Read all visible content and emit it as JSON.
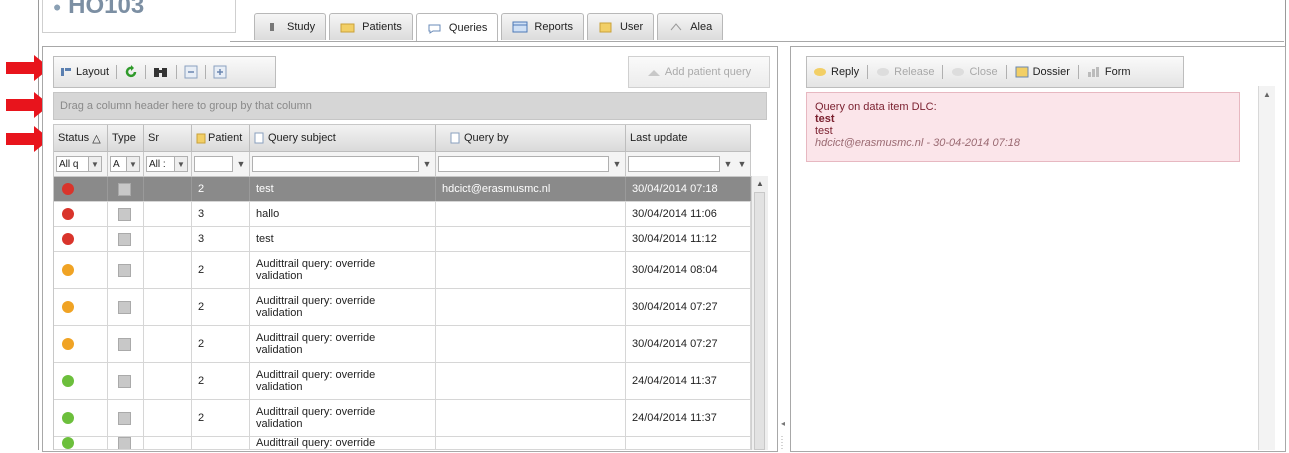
{
  "app": {
    "logo_text": "HO103"
  },
  "tabs": [
    {
      "label": "Study",
      "icon": "study-icon"
    },
    {
      "label": "Patients",
      "icon": "patients-icon"
    },
    {
      "label": "Queries",
      "icon": "queries-icon",
      "active": true
    },
    {
      "label": "Reports",
      "icon": "reports-icon"
    },
    {
      "label": "User",
      "icon": "user-icon"
    },
    {
      "label": "Alea",
      "icon": "alea-icon"
    }
  ],
  "toolbar": {
    "layout_label": "Layout",
    "add_patient_query_label": "Add patient query"
  },
  "group_bar": {
    "text": "Drag a column header here to group by that column"
  },
  "columns": [
    {
      "label": "Status",
      "sort": "△"
    },
    {
      "label": "Type"
    },
    {
      "label": "Sr"
    },
    {
      "label": "Patient"
    },
    {
      "label": "Query subject"
    },
    {
      "label": "Query by"
    },
    {
      "label": "Last update"
    }
  ],
  "filters": {
    "status": "All q",
    "type": "A",
    "sr": "All :"
  },
  "rows": [
    {
      "status": "red",
      "patient": "2",
      "subject": "test",
      "by": "hdcict@erasmusmc.nl",
      "updated": "30/04/2014 07:18",
      "selected": true
    },
    {
      "status": "red",
      "patient": "3",
      "subject": "hallo",
      "by": "",
      "updated": "30/04/2014 11:06"
    },
    {
      "status": "red",
      "patient": "3",
      "subject": "test",
      "by": "",
      "updated": "30/04/2014 11:12"
    },
    {
      "status": "orange",
      "patient": "2",
      "subject": "Audittrail query: override validation",
      "by": "",
      "updated": "30/04/2014 08:04"
    },
    {
      "status": "orange",
      "patient": "2",
      "subject": "Audittrail query: override validation",
      "by": "",
      "updated": "30/04/2014 07:27"
    },
    {
      "status": "orange",
      "patient": "2",
      "subject": "Audittrail query: override validation",
      "by": "",
      "updated": "30/04/2014 07:27"
    },
    {
      "status": "green",
      "patient": "2",
      "subject": "Audittrail query: override validation",
      "by": "",
      "updated": "24/04/2014 11:37"
    },
    {
      "status": "green",
      "patient": "2",
      "subject": "Audittrail query: override validation",
      "by": "",
      "updated": "24/04/2014 11:37"
    },
    {
      "status": "green",
      "patient": "",
      "subject": "Audittrail query: override",
      "by": "",
      "updated": ""
    }
  ],
  "right_toolbar": {
    "reply": "Reply",
    "release": "Release",
    "close": "Close",
    "dossier": "Dossier",
    "form": "Form"
  },
  "query_detail": {
    "title": "Query on data item DLC:",
    "subject": "test",
    "body": "test",
    "meta": "hdcict@erasmusmc.nl - 30-04-2014 07:18"
  },
  "colors": {
    "red": "#d9342b",
    "orange": "#f0a324",
    "green": "#6cbf3c",
    "arrow": "#e8141c",
    "selected_row": "#8a8a8a",
    "query_bg": "#fbe5ea"
  }
}
